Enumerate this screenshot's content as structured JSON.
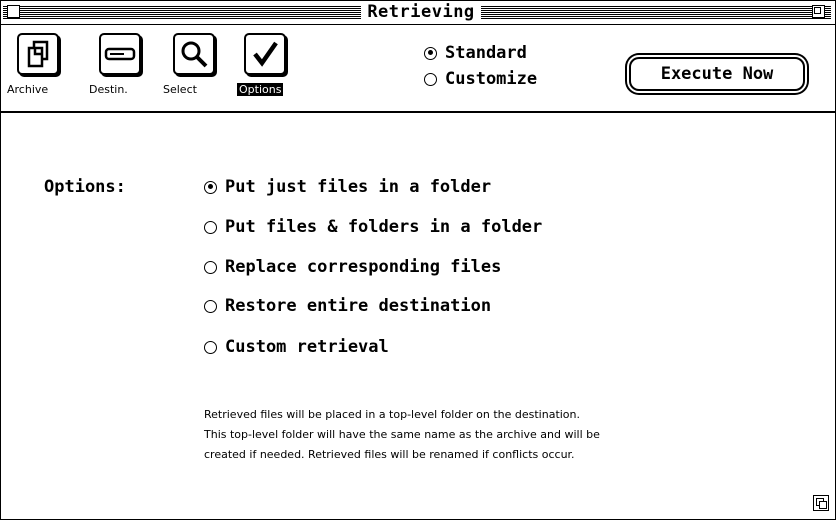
{
  "window": {
    "title": "Retrieving"
  },
  "toolbar": {
    "tools": [
      {
        "label": "Archive",
        "icon": "archive-icon"
      },
      {
        "label": "Destin.",
        "icon": "destination-icon"
      },
      {
        "label": "Select",
        "icon": "magnifier-icon"
      },
      {
        "label": "Options",
        "icon": "checkmark-icon",
        "selected": true
      }
    ],
    "mode": {
      "selected": "Standard",
      "options": [
        "Standard",
        "Customize"
      ]
    },
    "execute_label": "Execute Now"
  },
  "content": {
    "options_label": "Options:",
    "selected_option": "Put just files in a folder",
    "options": [
      "Put just files in a folder",
      "Put files & folders in a folder",
      "Replace corresponding files",
      "Restore entire destination",
      "Custom retrieval"
    ],
    "description": [
      "Retrieved files will be placed in a top-level folder on the destination.",
      "This top-level folder will have the same name as the archive and will be",
      "created if needed.  Retrieved files will be renamed if conflicts occur."
    ]
  }
}
